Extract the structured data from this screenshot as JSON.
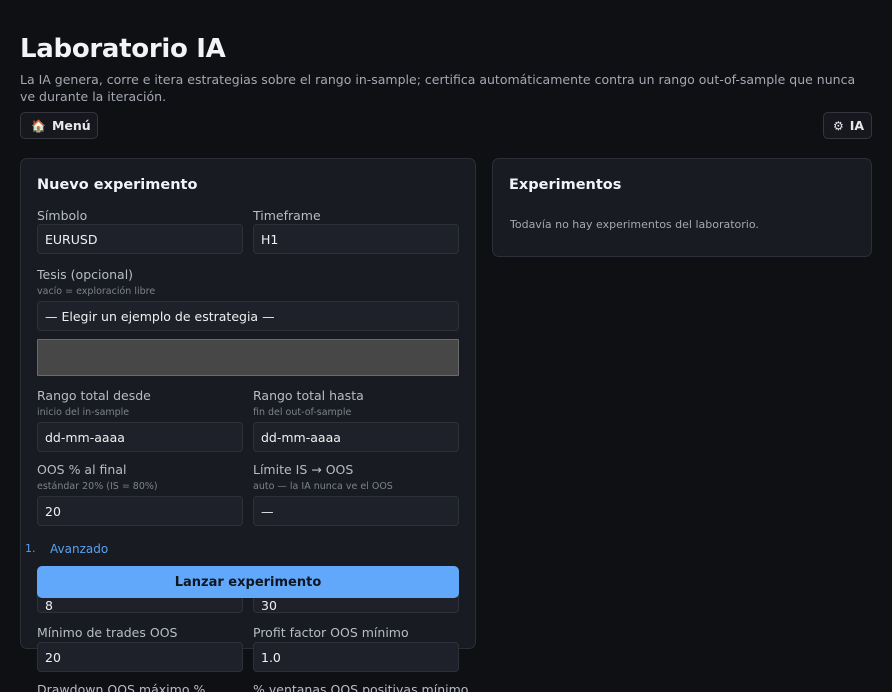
{
  "header": {
    "title": "Laboratorio IA",
    "subtitle": "La IA genera, corre e itera estrategias sobre el rango in-sample; certifica automáticamente contra un rango out-of-sample que nunca ve durante la iteración.",
    "menu_button": {
      "icon": "🏠",
      "label": "Menú"
    },
    "ia_button": {
      "icon": "⚙",
      "label": "IA"
    }
  },
  "new_experiment": {
    "title": "Nuevo experimento",
    "symbol": {
      "label": "Símbolo",
      "value": "EURUSD"
    },
    "timeframe": {
      "label": "Timeframe",
      "value": "H1"
    },
    "thesis": {
      "label": "Tesis (opcional)",
      "hint": "vacío = exploración libre",
      "select_value": "— Elegir un ejemplo de estrategia —"
    },
    "range_from": {
      "label": "Rango total desde",
      "hint": "inicio del in-sample",
      "value": "dd-mm-aaaa"
    },
    "range_to": {
      "label": "Rango total hasta",
      "hint": "fin del out-of-sample",
      "value": "dd-mm-aaaa"
    },
    "oos_pct": {
      "label": "OOS % al final",
      "hint": "estándar 20% (IS = 80%)",
      "value": "20"
    },
    "is_oos_limit": {
      "label": "Límite IS → OOS",
      "hint": "auto — la IA nunca ve el OOS",
      "value": "—"
    },
    "advanced": {
      "marker": "1.",
      "label": "Avanzado"
    },
    "advanced_row1": {
      "left_value": "8",
      "right_value": "30"
    },
    "min_trades_oos": {
      "label": "Mínimo de trades OOS",
      "value": "20"
    },
    "min_profit_factor": {
      "label": "Profit factor OOS mínimo",
      "value": "1.0"
    },
    "max_drawdown": {
      "label": "Drawdown OOS máximo %"
    },
    "min_positive_windows": {
      "label": "% ventanas OOS positivas mínimo"
    },
    "launch_button": "Lanzar experimento"
  },
  "experiments": {
    "title": "Experimentos",
    "empty_text": "Todavía no hay experimentos del laboratorio."
  },
  "colors": {
    "background": "#0f1014",
    "card": "#181b21",
    "accent": "#62a8fa",
    "link": "#5aa0f0"
  }
}
